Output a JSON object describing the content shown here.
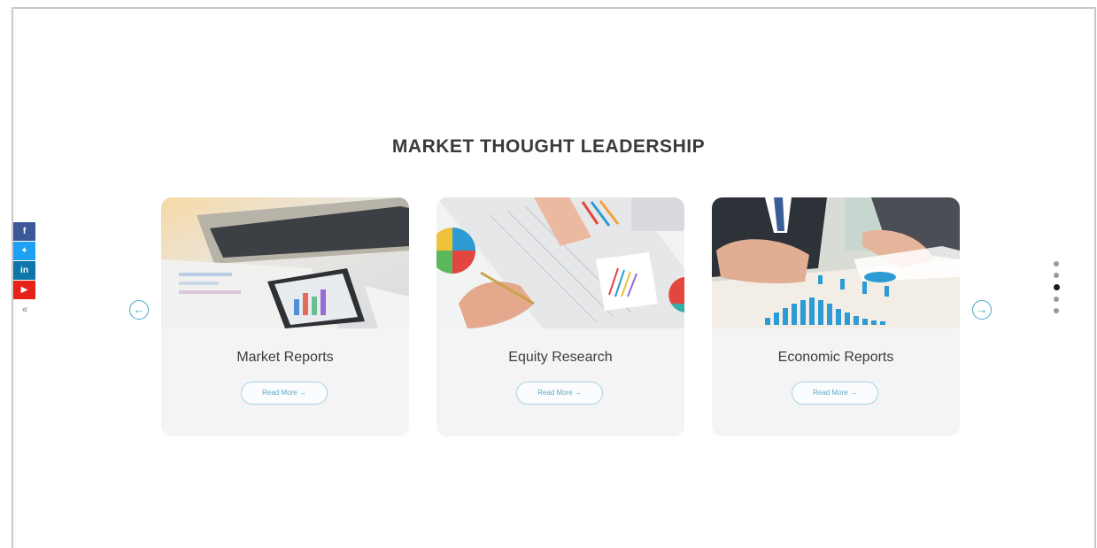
{
  "section": {
    "title": "MARKET THOUGHT LEADERSHIP"
  },
  "social": {
    "items": [
      {
        "name": "facebook",
        "glyph": "f"
      },
      {
        "name": "twitter",
        "glyph": "✦"
      },
      {
        "name": "linkedin",
        "glyph": "in"
      },
      {
        "name": "youtube",
        "glyph": "▶"
      }
    ],
    "collapse_glyph": "«"
  },
  "carousel": {
    "prev_glyph": "←",
    "next_glyph": "→",
    "cards": [
      {
        "title": "Market Reports",
        "read_more": "Read More →"
      },
      {
        "title": "Equity Research",
        "read_more": "Read More →"
      },
      {
        "title": "Economic Reports",
        "read_more": "Read More →"
      }
    ],
    "dots_total": 5,
    "dots_active_index": 2
  },
  "colors": {
    "accent": "#49a6c9",
    "facebook": "#3b5998",
    "twitter": "#1da1f2",
    "linkedin": "#0e76a8",
    "youtube": "#e62117"
  }
}
